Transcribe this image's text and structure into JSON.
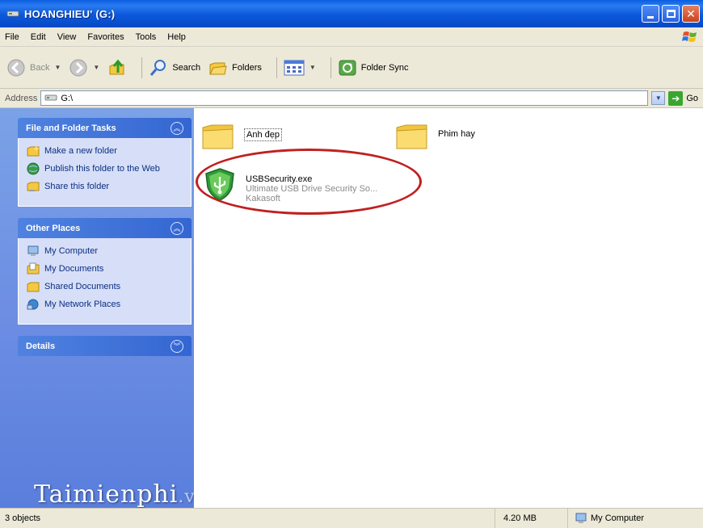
{
  "window": {
    "title": "HOANGHIEU' (G:)",
    "buttons": [
      "minimize",
      "maximize",
      "close"
    ]
  },
  "menu": {
    "items": [
      "File",
      "Edit",
      "View",
      "Favorites",
      "Tools",
      "Help"
    ]
  },
  "toolbar": {
    "back_label": "Back",
    "search_label": "Search",
    "folders_label": "Folders",
    "folder_sync_label": "Folder Sync"
  },
  "address": {
    "label": "Address",
    "value": "G:\\",
    "go_label": "Go"
  },
  "taskpane": {
    "file_tasks": {
      "title": "File and Folder Tasks",
      "items": [
        {
          "label": "Make a new folder",
          "icon": "new-folder-icon"
        },
        {
          "label": "Publish this folder to the Web",
          "icon": "globe-icon"
        },
        {
          "label": "Share this folder",
          "icon": "share-folder-icon"
        }
      ]
    },
    "other_places": {
      "title": "Other Places",
      "items": [
        {
          "label": "My Computer",
          "icon": "computer-icon"
        },
        {
          "label": "My Documents",
          "icon": "documents-icon"
        },
        {
          "label": "Shared Documents",
          "icon": "shared-folder-icon"
        },
        {
          "label": "My Network Places",
          "icon": "network-icon"
        }
      ]
    },
    "details": {
      "title": "Details"
    }
  },
  "files": [
    {
      "name": "Anh đẹp",
      "type": "folder"
    },
    {
      "name": "Phim hay",
      "type": "folder"
    },
    {
      "name": "USBSecurity.exe",
      "description": "Ultimate USB Drive Security So...",
      "company": "Kakasoft",
      "type": "exe"
    }
  ],
  "status": {
    "objects": "3 objects",
    "size": "4.20 MB",
    "zone": "My Computer"
  },
  "watermark": {
    "text": "Taimienphi",
    "suffix": ".vn"
  },
  "colors": {
    "titlebar": "#0b58dc",
    "taskpane": "#6d8ee3",
    "highlight_circle": "#c02020"
  }
}
